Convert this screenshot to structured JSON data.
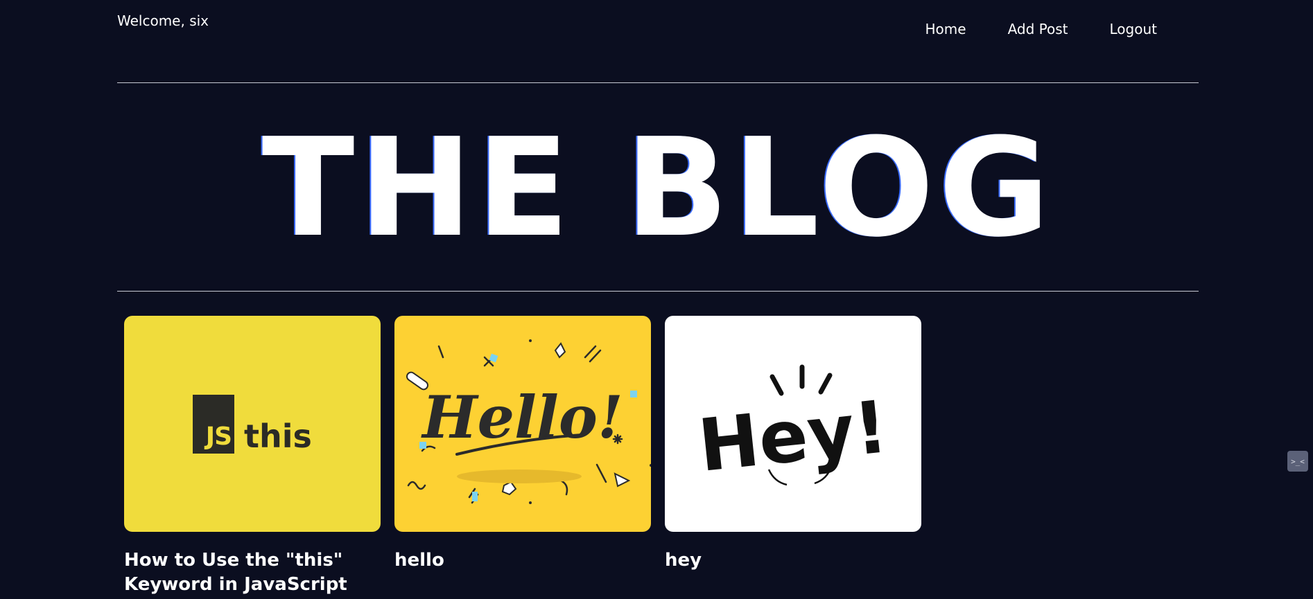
{
  "header": {
    "welcome": "Welcome, six",
    "nav": [
      {
        "label": "Home"
      },
      {
        "label": "Add Post"
      },
      {
        "label": "Logout"
      }
    ]
  },
  "hero": {
    "title": "THE BLOG"
  },
  "posts": [
    {
      "title": "How to Use the \"this\" Keyword in JavaScript",
      "image": {
        "kind": "js-this-logo",
        "background": "#f0dc3c",
        "logo_box": "JS",
        "logo_word": "this"
      }
    },
    {
      "title": "hello",
      "image": {
        "kind": "hello-lettering",
        "background": "#fdd133",
        "lettering": "Hello!"
      }
    },
    {
      "title": "hey",
      "image": {
        "kind": "hey-lettering",
        "background": "#ffffff",
        "lettering": "Hey!"
      }
    }
  ],
  "colors": {
    "page_background": "#0b0e20",
    "text": "#ffffff",
    "rule": "#c9cbd4"
  },
  "widget": {
    "icon": "terminal-face-icon"
  }
}
